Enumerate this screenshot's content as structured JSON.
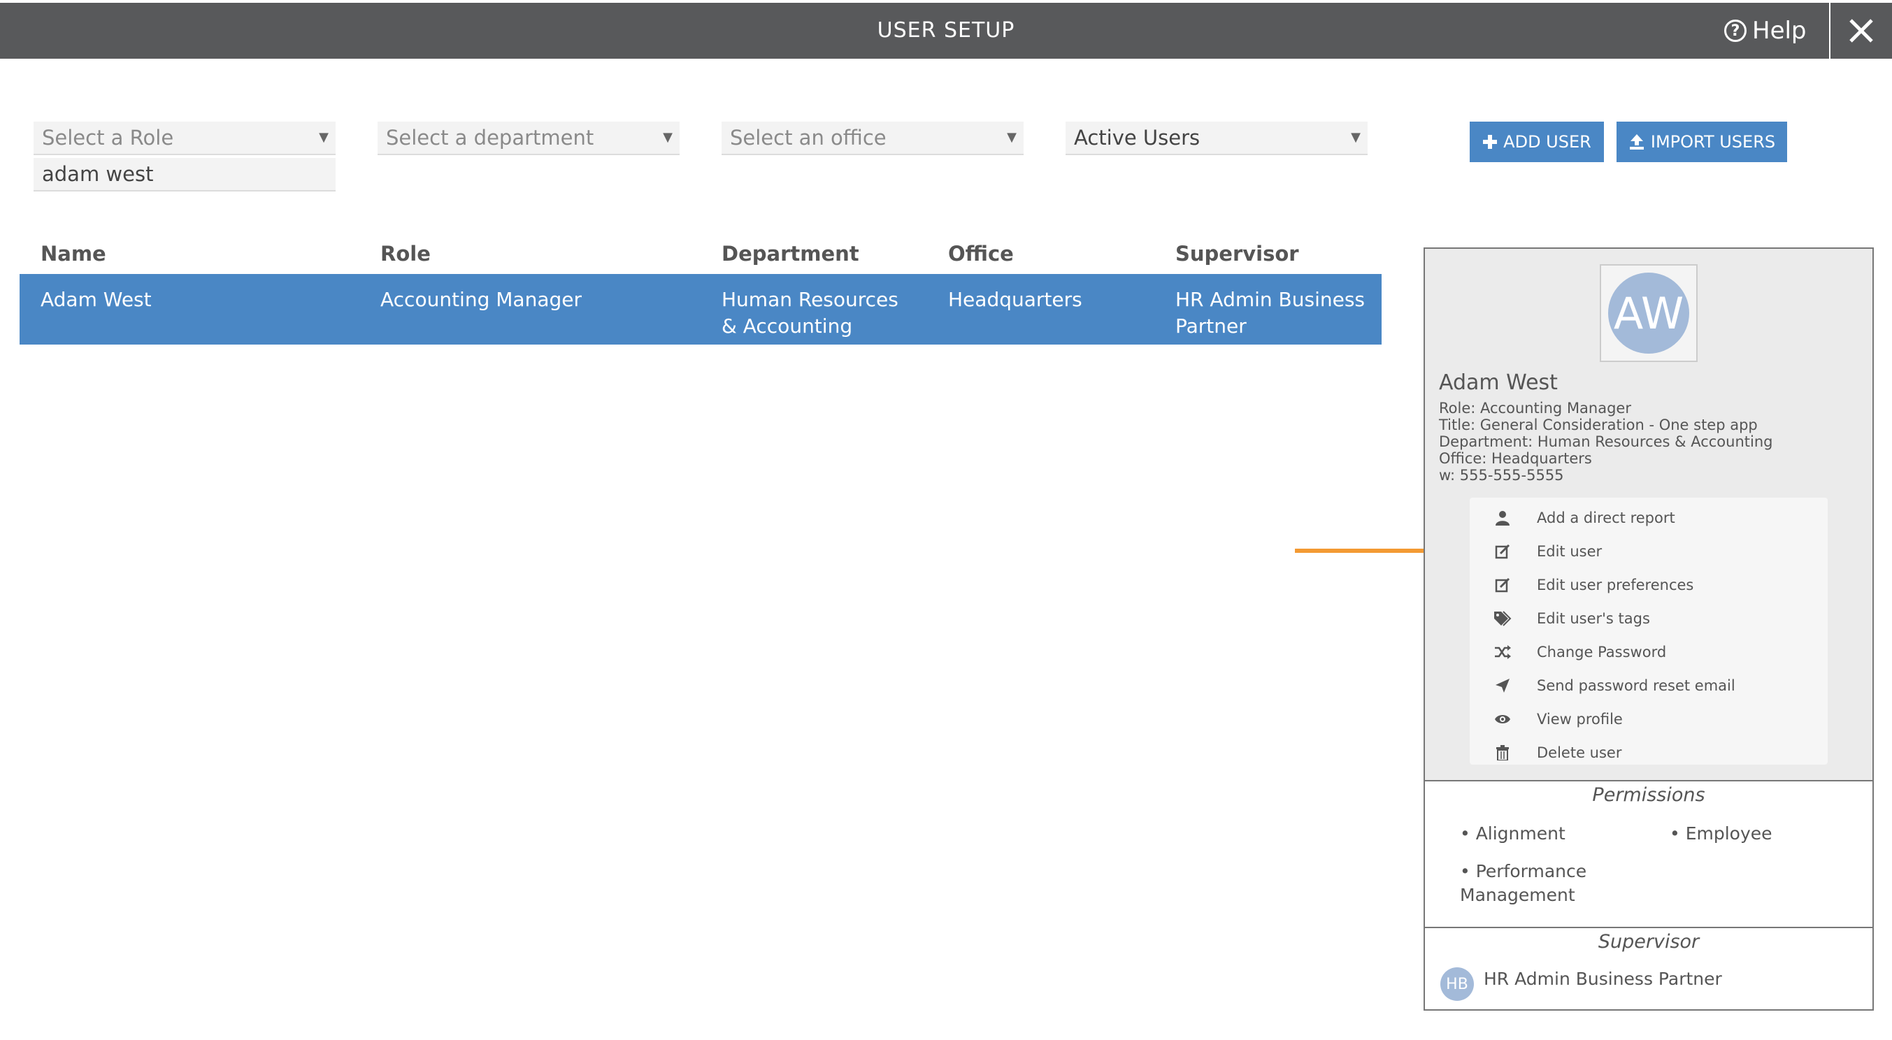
{
  "header": {
    "title": "USER SETUP",
    "help_label": "Help"
  },
  "filters": {
    "role": "Select a Role",
    "department": "Select a department",
    "office": "Select an office",
    "status": "Active Users",
    "search_value": "adam west"
  },
  "actions": {
    "add_user": "ADD USER",
    "import_users": "IMPORT USERS"
  },
  "table": {
    "columns": [
      "Name",
      "Role",
      "Department",
      "Office",
      "Supervisor"
    ],
    "rows": [
      {
        "name": "Adam West",
        "role": "Accounting Manager",
        "department_line1": "Human Resources",
        "department_line2": "& Accounting",
        "office": "Headquarters",
        "supervisor_line1": "HR Admin Business",
        "supervisor_line2": "Partner"
      }
    ]
  },
  "detail": {
    "initials": "AW",
    "name": "Adam West",
    "info": [
      "Role: Accounting Manager",
      "Title: General Consideration - One step app",
      "Department: Human Resources & Accounting",
      "Office: Headquarters",
      "w: 555-555-5555"
    ],
    "menu": [
      {
        "label": "Add a direct report",
        "icon": "user-icon"
      },
      {
        "label": "Edit user",
        "icon": "edit-icon"
      },
      {
        "label": "Edit user preferences",
        "icon": "edit-icon"
      },
      {
        "label": "Edit user's tags",
        "icon": "tags-icon"
      },
      {
        "label": "Change Password",
        "icon": "shuffle-icon"
      },
      {
        "label": "Send password reset email",
        "icon": "send-icon"
      },
      {
        "label": "View profile",
        "icon": "eye-icon"
      },
      {
        "label": "Delete user",
        "icon": "trash-icon"
      }
    ],
    "permissions_title": "Permissions",
    "permissions": [
      "• Alignment",
      "• Employee",
      "• Performance",
      "Management"
    ],
    "supervisor_title": "Supervisor",
    "supervisor_initials": "HB",
    "supervisor_name": "HR Admin Business Partner"
  },
  "colors": {
    "header_bg": "#58595b",
    "accent": "#4a87c5",
    "arrow": "#f39a33"
  }
}
